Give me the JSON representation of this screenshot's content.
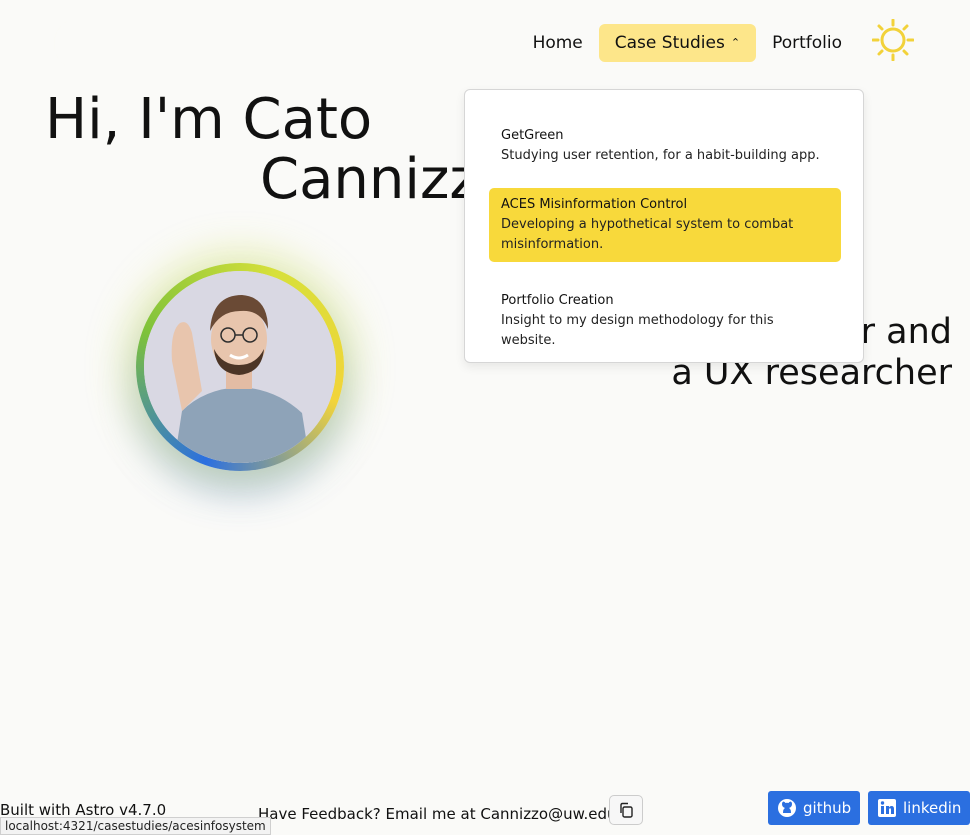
{
  "nav": {
    "home": "Home",
    "case_studies": "Case Studies",
    "case_studies_chevron": "^",
    "portfolio": "Portfolio",
    "theme_icon": "sun-icon",
    "logo_icon": "double-crescent-logo"
  },
  "hero": {
    "line1": "Hi, I'm Cato",
    "line2": "Cannizzo",
    "tagline_line1": "a UX designer and",
    "tagline_line2": "a UX researcher"
  },
  "dropdown": {
    "items": [
      {
        "title": "GetGreen",
        "desc": "Studying user retention, for a habit-building app."
      },
      {
        "title": "ACES Misinformation Control",
        "desc": "Developing a hypothetical system to combat misinformation."
      },
      {
        "title": "Portfolio Creation",
        "desc": "Insight to my design methodology for this website."
      }
    ]
  },
  "footer": {
    "built": "Built with Astro v4.7.0",
    "feedback": "Have Feedback? Email me at Cannizzo@uw.edu",
    "github": "github",
    "linkedin": "linkedin"
  },
  "statusbar": {
    "url": "localhost:4321/casestudies/acesinfosystem"
  },
  "colors": {
    "accent_yellow": "#f8d93b",
    "active_nav": "#fde68a",
    "social_blue": "#2b6fe0"
  }
}
